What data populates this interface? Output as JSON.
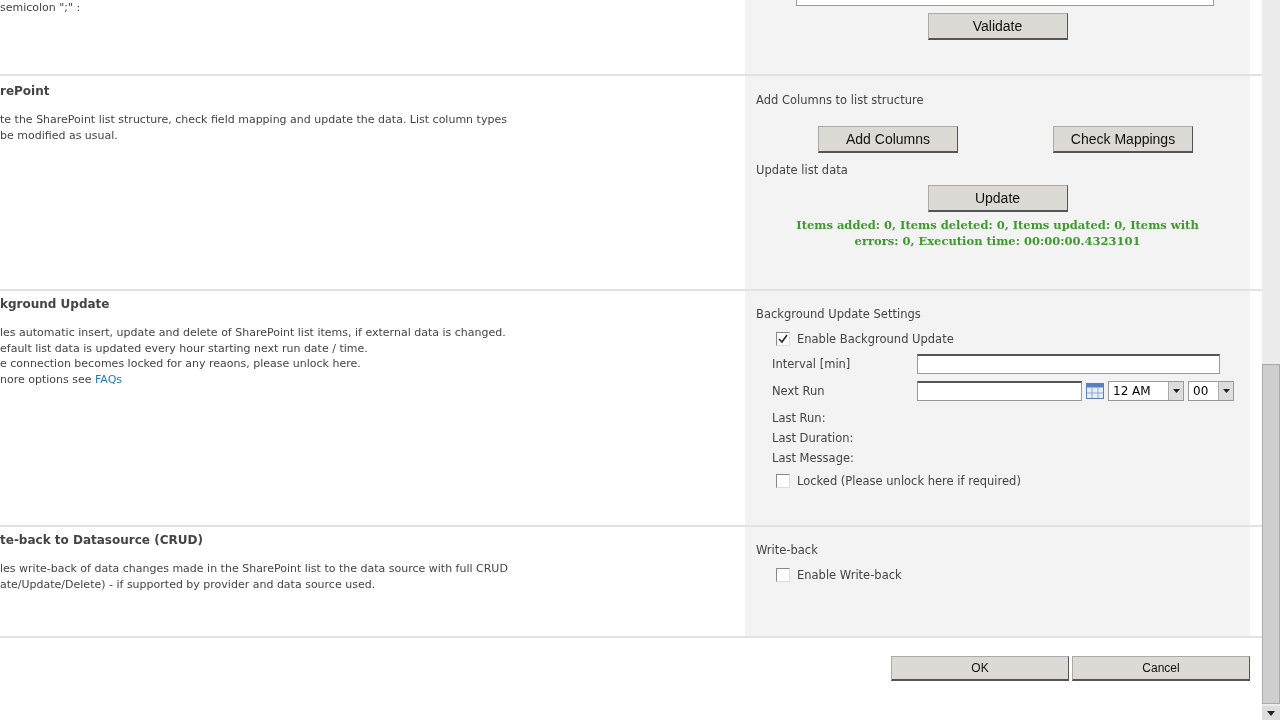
{
  "top": {
    "left_text": "semicolon \";\" :",
    "validate_button": "Validate"
  },
  "sections": [
    {
      "kind": "update",
      "title": "rePoint",
      "description": [
        "te the SharePoint list structure, check field mapping and update the data. List column types",
        "be modified as usual."
      ],
      "add_columns_label": "Add Columns to list structure",
      "buttons": [
        "Add Columns",
        "Check Mappings"
      ],
      "update_label": "Update list data",
      "update_button": "Update",
      "result": "Items added: 0, Items deleted: 0, Items updated: 0, Items with errors: 0, Execution time: 00:00:00.4323101"
    },
    {
      "kind": "background",
      "title": "kground Update",
      "description": [
        "les automatic insert, update and delete of SharePoint list items, if external data is changed.",
        "efault list data is updated every hour starting next run date / time.",
        "e connection becomes locked for any reaons, please unlock here."
      ],
      "link_prefix": "nore options see ",
      "link": "FAQs",
      "settings_label": "Background Update Settings",
      "enable": {
        "label": "Enable Background Update",
        "checked": true
      },
      "interval_label": "Interval [min]",
      "next_run_label": "Next Run",
      "hour": "12 AM",
      "minute": "00",
      "info": [
        "Last Run:",
        "Last Duration:",
        "Last Message:"
      ],
      "locked": {
        "label": "Locked (Please unlock here if required)",
        "checked": false
      }
    },
    {
      "kind": "writeback",
      "title": "te-back to Datasource (CRUD)",
      "description": [
        "les write-back of data changes made in the SharePoint list to the data source with full CRUD",
        "ate/Update/Delete) - if supported by provider and data source used."
      ],
      "settings_label": "Write-back",
      "enable": {
        "label": "Enable Write-back",
        "checked": false
      }
    }
  ],
  "footer_buttons": [
    "OK",
    "Cancel"
  ]
}
